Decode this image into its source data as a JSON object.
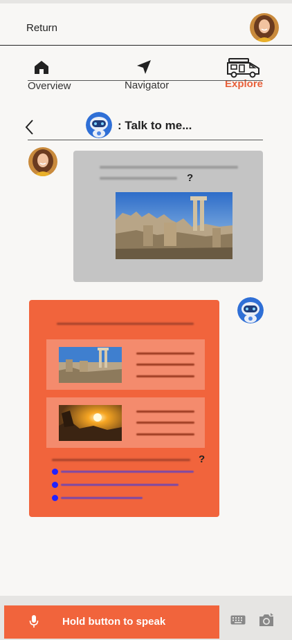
{
  "header": {
    "return_label": "Return",
    "avatar_icon": "user-avatar"
  },
  "nav": {
    "items": [
      {
        "label": "Overview",
        "icon": "home-icon"
      },
      {
        "label": "Navigator",
        "icon": "navigation-arrow-icon"
      },
      {
        "label": "Explore",
        "icon": "camper-van-icon",
        "active": true
      }
    ],
    "accent_color": "#e8603a"
  },
  "chat": {
    "title": ": Talk to me...",
    "back_icon": "chevron-left-icon",
    "bot_icon": "robot-icon",
    "user_message": {
      "question_mark": "?"
    },
    "bot_message": {
      "question_mark": "?"
    }
  },
  "bottom": {
    "speak_label": "Hold button to speak",
    "mic_icon": "microphone-icon",
    "keyboard_icon": "keyboard-icon",
    "camera_icon": "camera-icon",
    "button_color": "#f1643c"
  }
}
